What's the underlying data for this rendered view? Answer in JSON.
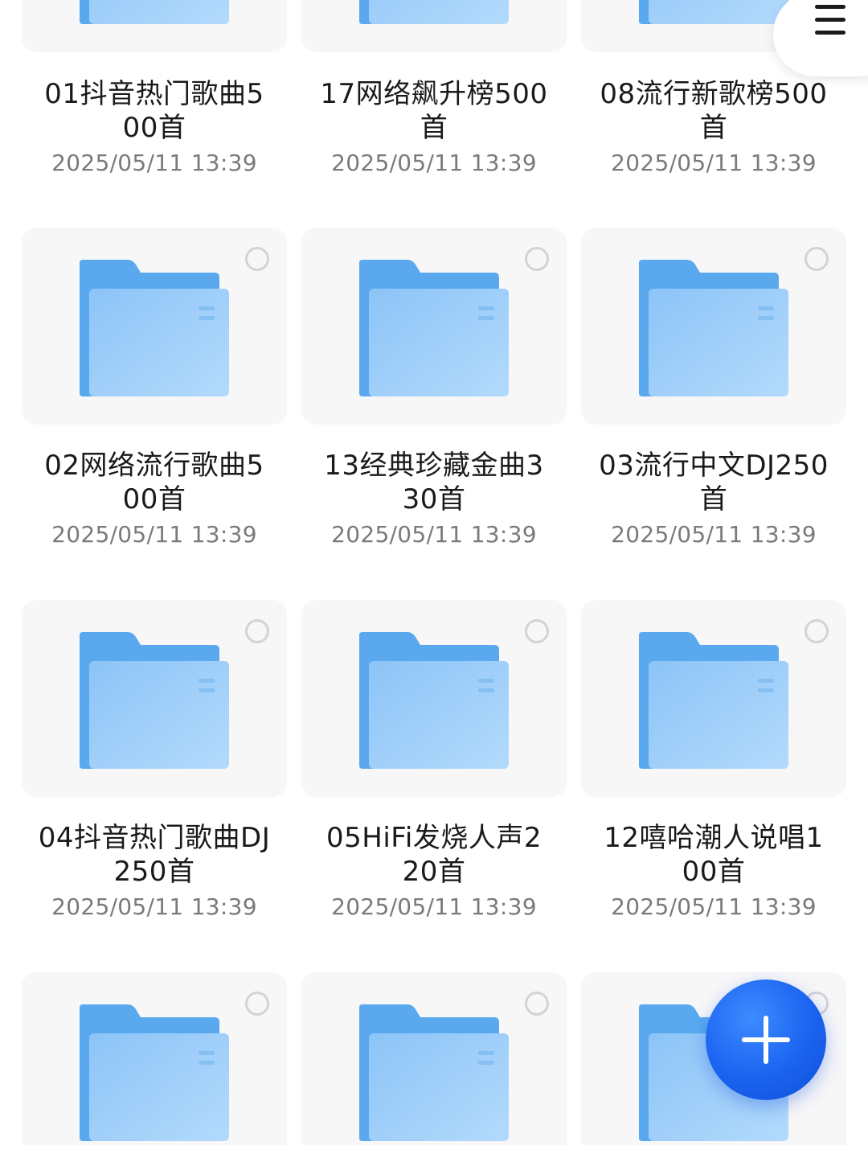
{
  "colors": {
    "folder_back": "#5aa9ef",
    "folder_front": "#9ccdf9",
    "accent": "#1a63f0",
    "card_bg": "#f7f7f8"
  },
  "icons": {
    "menu": "menu-icon",
    "folder": "folder-icon",
    "select": "select-circle-icon",
    "add": "plus-icon"
  },
  "folders": [
    {
      "name": "01抖音热门歌曲500首",
      "date": "2025/05/11 13:39"
    },
    {
      "name": "17网络飙升榜500首",
      "date": "2025/05/11 13:39"
    },
    {
      "name": "08流行新歌榜500首",
      "date": "2025/05/11 13:39"
    },
    {
      "name": "02网络流行歌曲500首",
      "date": "2025/05/11 13:39"
    },
    {
      "name": "13经典珍藏金曲330首",
      "date": "2025/05/11 13:39"
    },
    {
      "name": "03流行中文DJ250首",
      "date": "2025/05/11 13:39"
    },
    {
      "name": "04抖音热门歌曲DJ250首",
      "date": "2025/05/11 13:39"
    },
    {
      "name": "05HiFi发烧人声220首",
      "date": "2025/05/11 13:39"
    },
    {
      "name": "12嘻哈潮人说唱100首",
      "date": "2025/05/11 13:39"
    }
  ]
}
